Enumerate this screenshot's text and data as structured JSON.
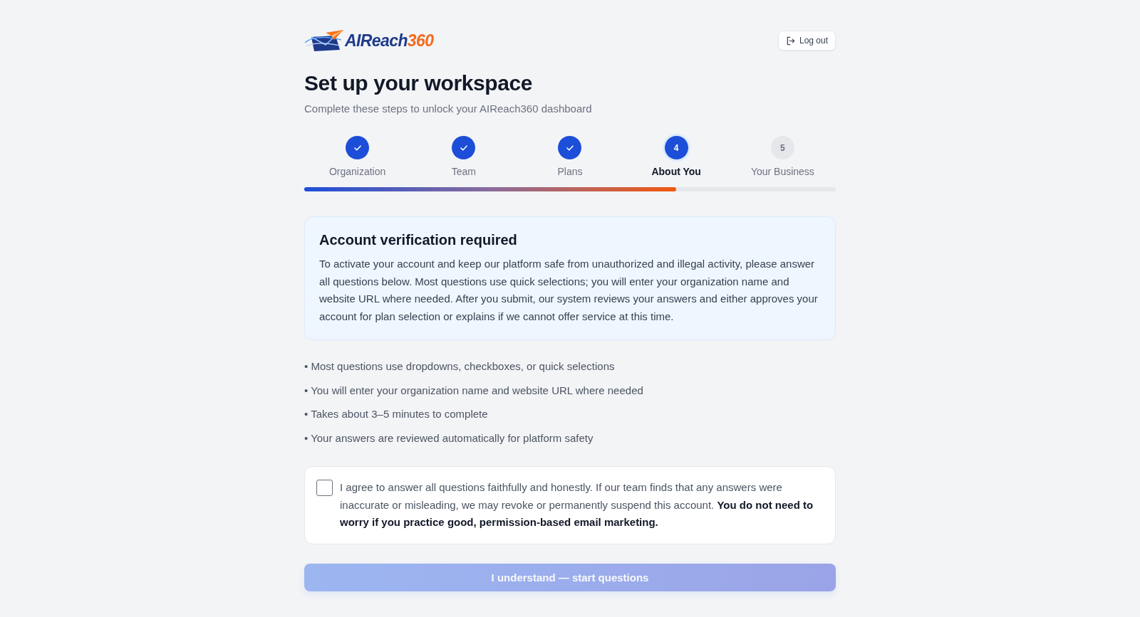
{
  "logo": {
    "name": "AIReach",
    "suffix": "360"
  },
  "logout_button": {
    "label": "Log out"
  },
  "title": "Set up your workspace",
  "subtitle": "Complete these steps to unlock your AIReach360 dashboard",
  "steps": [
    {
      "label": "Organization",
      "completed": true,
      "selected": false
    },
    {
      "label": "Team",
      "completed": true,
      "selected": false
    },
    {
      "label": "Plans",
      "completed": true,
      "selected": false
    },
    {
      "label": "About You",
      "number": "4",
      "completed": false,
      "selected": true
    },
    {
      "label": "Your Business",
      "number": "5",
      "completed": false,
      "selected": false
    }
  ],
  "progress": {
    "level": 0.7
  },
  "notice": {
    "title": "Account verification required",
    "body": "To activate your account and keep our platform safe from unauthorized and illegal activity, please answer all questions below. Most questions use quick selections; you will enter your organization name and website URL where needed. After you submit, our system reviews your answers and either approves your account for plan selection or explains if we cannot offer service at this time."
  },
  "bullets": [
    "• Most questions use dropdowns, checkboxes, or quick selections",
    "• You will enter your organization name and website URL where needed",
    "• Takes about 3–5 minutes to complete",
    "• Your answers are reviewed automatically for platform safety"
  ],
  "consent": {
    "checked": false,
    "text": "I agree to answer all questions faithfully and honestly. If our team finds that any answers were inaccurate or misleading, we may revoke or permanently suspend this account. **You do not need to worry if you practice good, permission-based email marketing.**"
  },
  "start_button": {
    "label": "I understand — start questions",
    "disabled": true
  }
}
